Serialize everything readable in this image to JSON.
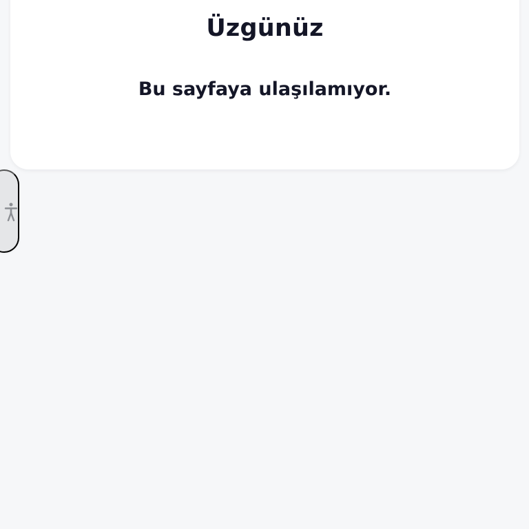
{
  "error_card": {
    "title": "Üzgünüz",
    "message": "Bu sayfaya ulaşılamıyor."
  },
  "accessibility_widget": {
    "icon": "accessibility-person-icon"
  },
  "colors": {
    "page_background": "#f6f7f9",
    "card_background": "#ffffff",
    "text": "#141627",
    "accessibility_tab_background": "#e5e6e8",
    "accessibility_icon": "#8c8e93"
  }
}
